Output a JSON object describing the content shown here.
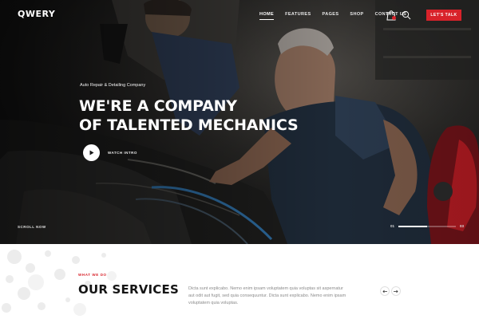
{
  "brand": {
    "logo": "QWERY",
    "accent_color": "#d8222a"
  },
  "header": {
    "nav": [
      {
        "label": "Home",
        "active": true
      },
      {
        "label": "Features",
        "active": false
      },
      {
        "label": "Pages",
        "active": false
      },
      {
        "label": "Shop",
        "active": false
      },
      {
        "label": "Contact Us",
        "active": false
      }
    ],
    "cart_icon": "shopping-bag-icon",
    "search_icon": "search-icon",
    "cta_label": "Let's Talk"
  },
  "hero": {
    "eyebrow": "Auto Repair & Detailing Company",
    "headline_line1": "We're a company",
    "headline_line2": "of talented mechanics",
    "play_label": "Watch Intro",
    "scroll_label": "Scroll Now",
    "slide_current": "01",
    "slide_total": "03",
    "slide_progress": 0.5
  },
  "services": {
    "eyebrow": "What We Do",
    "title": "Our Services",
    "text": "Dicta sunt explicabo. Nemo enim ipsam voluptatem quia voluptas sit aspernatur aut odit aut fugit, sed quia consequuntur. Dicta sunt explicabo. Nemo enim ipsam voluptatem quia voluptas.",
    "prev_icon": "arrow-left-icon",
    "next_icon": "arrow-right-icon"
  }
}
